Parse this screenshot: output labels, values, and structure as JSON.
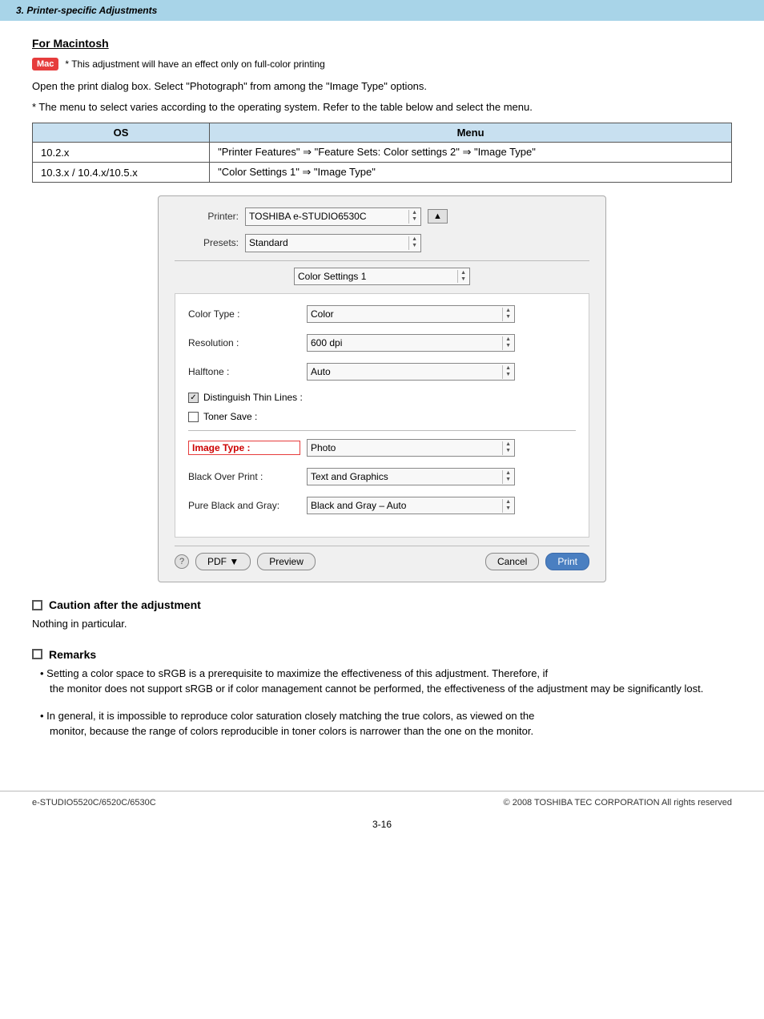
{
  "topbar": {
    "title": "3. Printer-specific Adjustments"
  },
  "section": {
    "for_mac_title": "For Macintosh",
    "mac_badge": "Mac",
    "mac_note": "* This adjustment will have an effect only on full-color printing",
    "para1": "Open the print dialog box.  Select \"Photograph\" from among the \"Image Type\" options.",
    "para2": "* The menu to select varies according to the operating system.  Refer to the table below and select the menu.",
    "table": {
      "headers": [
        "OS",
        "Menu"
      ],
      "rows": [
        [
          "10.2.x",
          "\"Printer Features\" ⇒ \"Feature Sets: Color settings 2\" ⇒ \"Image Type\""
        ],
        [
          "10.3.x / 10.4.x/10.5.x",
          "\"Color Settings 1\" ⇒ \"Image Type\""
        ]
      ]
    }
  },
  "dialog": {
    "printer_label": "Printer:",
    "printer_value": "TOSHIBA e-STUDIO6530C",
    "presets_label": "Presets:",
    "presets_value": "Standard",
    "color_settings_value": "Color Settings 1",
    "color_type_label": "Color Type :",
    "color_type_value": "Color",
    "resolution_label": "Resolution :",
    "resolution_value": "600 dpi",
    "halftone_label": "Halftone :",
    "halftone_value": "Auto",
    "distinguish_label": "Distinguish Thin Lines :",
    "toner_save_label": "Toner Save :",
    "image_type_label": "Image Type :",
    "image_type_value": "Photo",
    "black_over_print_label": "Black Over Print :",
    "black_over_print_value": "Text and Graphics",
    "pure_black_label": "Pure Black and Gray:",
    "pure_black_value": "Black and Gray – Auto",
    "btn_pdf": "PDF ▼",
    "btn_preview": "Preview",
    "btn_cancel": "Cancel",
    "btn_print": "Print"
  },
  "caution": {
    "heading": "Caution after the adjustment",
    "text": "Nothing in particular."
  },
  "remarks": {
    "heading": "Remarks",
    "bullets": [
      {
        "main": "• Setting a color space to sRGB is a prerequisite to maximize the effectiveness of this adjustment.  Therefore, if",
        "indent": "the monitor does not support sRGB or if color management cannot be performed, the effectiveness of the adjustment may be significantly lost."
      },
      {
        "main": "• In general, it is impossible to reproduce color saturation closely matching the true colors, as viewed on the",
        "indent": "monitor, because the range of colors reproducible in toner colors is narrower than the one on the monitor."
      }
    ]
  },
  "footer": {
    "left": "e-STUDIO5520C/6520C/6530C",
    "right": "© 2008 TOSHIBA TEC CORPORATION All rights reserved",
    "page": "3-16"
  }
}
